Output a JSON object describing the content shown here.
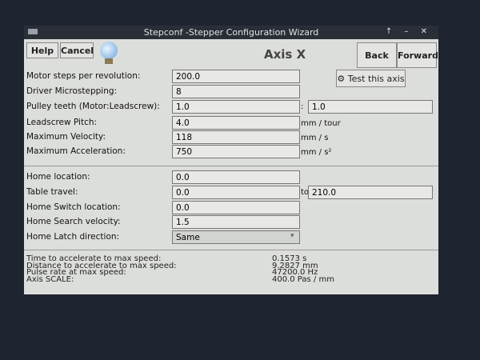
{
  "window": {
    "title": "Stepconf -Stepper Configuration Wizard",
    "controls": "↑ – ✕"
  },
  "toolbar": {
    "help": "Help",
    "cancel": "Cancel",
    "heading": "Axis X",
    "back": "Back",
    "forward": "Forward",
    "test": "Test this axis"
  },
  "fields": [
    {
      "label": "Motor steps per revolution:",
      "value": "200.0"
    },
    {
      "label": "Driver Microstepping:",
      "value": "8"
    },
    {
      "label": "Pulley teeth (Motor:Leadscrew):",
      "value": "1.0",
      "sep": ":",
      "value2": "1.0"
    },
    {
      "label": "Leadscrew Pitch:",
      "value": "4.0",
      "unit": "mm / tour"
    },
    {
      "label": "Maximum Velocity:",
      "value": "118",
      "unit": "mm / s"
    },
    {
      "label": "Maximum Acceleration:",
      "value": "750",
      "unit": "mm / s²"
    }
  ],
  "home": [
    {
      "label": "Home location:",
      "value": "0.0"
    },
    {
      "label": "Table travel:",
      "value": "0.0",
      "sep": "to",
      "value2": "210.0"
    },
    {
      "label": "Home Switch location:",
      "value": "0.0"
    },
    {
      "label": "Home Search velocity:",
      "value": "1.5"
    },
    {
      "label": "Home Latch direction:",
      "value": "Same"
    }
  ],
  "info": [
    {
      "label": "Time to accelerate to max speed:",
      "value": "0.1573 s"
    },
    {
      "label": "Distance to accelerate to max speed:",
      "value": "9.2827 mm"
    },
    {
      "label": "Pulse rate at max speed:",
      "value": "47200.0 Hz"
    },
    {
      "label": "Axis SCALE:",
      "value": "400.0 Pas / mm"
    }
  ]
}
